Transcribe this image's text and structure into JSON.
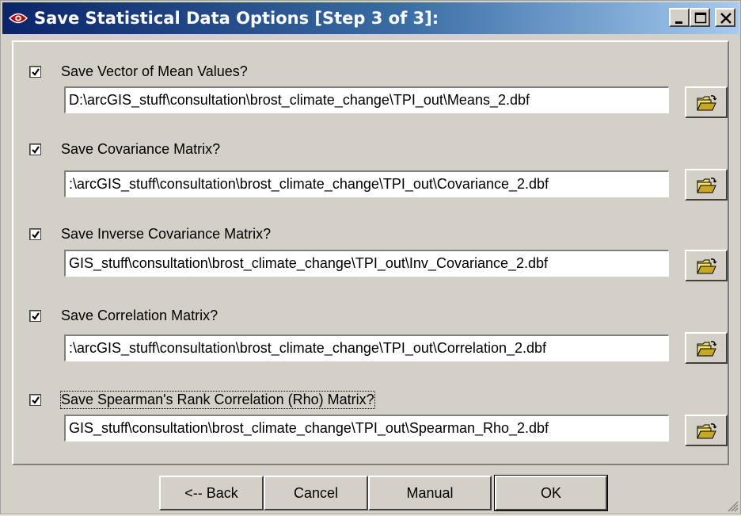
{
  "window": {
    "title": "Save Statistical Data Options [Step 3 of 3]:"
  },
  "options": [
    {
      "label": "Save Vector of Mean Values?",
      "checked": true,
      "path": "D:\\arcGIS_stuff\\consultation\\brost_climate_change\\TPI_out\\Means_2.dbf"
    },
    {
      "label": "Save Covariance Matrix?",
      "checked": true,
      "path": ":\\arcGIS_stuff\\consultation\\brost_climate_change\\TPI_out\\Covariance_2.dbf"
    },
    {
      "label": "Save Inverse Covariance Matrix?",
      "checked": true,
      "path": "GIS_stuff\\consultation\\brost_climate_change\\TPI_out\\Inv_Covariance_2.dbf"
    },
    {
      "label": "Save Correlation Matrix?",
      "checked": true,
      "path": ":\\arcGIS_stuff\\consultation\\brost_climate_change\\TPI_out\\Correlation_2.dbf"
    },
    {
      "label": "Save Spearman's Rank Correlation (Rho) Matrix?",
      "checked": true,
      "path": "GIS_stuff\\consultation\\brost_climate_change\\TPI_out\\Spearman_Rho_2.dbf"
    }
  ],
  "buttons": {
    "back": "<-- Back",
    "cancel": "Cancel",
    "manual": "Manual",
    "ok": "OK"
  }
}
